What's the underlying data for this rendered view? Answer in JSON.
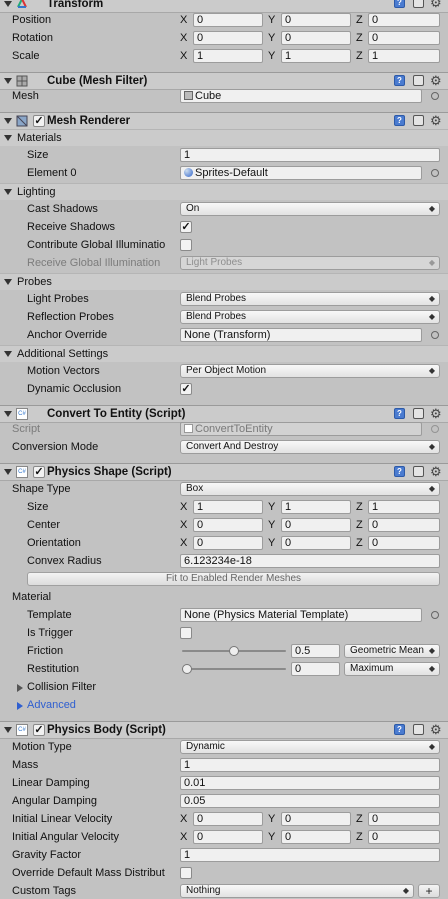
{
  "transform": {
    "title": "Transform",
    "rows": [
      {
        "label": "Position",
        "x": "0",
        "y": "0",
        "z": "0"
      },
      {
        "label": "Rotation",
        "x": "0",
        "y": "0",
        "z": "0"
      },
      {
        "label": "Scale",
        "x": "1",
        "y": "1",
        "z": "1"
      }
    ]
  },
  "axis": {
    "x": "X",
    "y": "Y",
    "z": "Z"
  },
  "mesh_filter": {
    "title": "Cube (Mesh Filter)",
    "mesh_label": "Mesh",
    "mesh_value": "Cube"
  },
  "mesh_renderer": {
    "title": "Mesh Renderer",
    "materials_header": "Materials",
    "size_label": "Size",
    "size_value": "1",
    "element0_label": "Element 0",
    "element0_value": "Sprites-Default",
    "lighting_header": "Lighting",
    "cast_shadows_label": "Cast Shadows",
    "cast_shadows_value": "On",
    "receive_shadows_label": "Receive Shadows",
    "contribute_gi_label": "Contribute Global Illuminatio",
    "receive_gi_label": "Receive Global Illumination",
    "receive_gi_value": "Light Probes",
    "probes_header": "Probes",
    "light_probes_label": "Light Probes",
    "light_probes_value": "Blend Probes",
    "reflection_probes_label": "Reflection Probes",
    "reflection_probes_value": "Blend Probes",
    "anchor_override_label": "Anchor Override",
    "anchor_override_value": "None (Transform)",
    "additional_header": "Additional Settings",
    "motion_vectors_label": "Motion Vectors",
    "motion_vectors_value": "Per Object Motion",
    "dynamic_occlusion_label": "Dynamic Occlusion"
  },
  "convert": {
    "title": "Convert To Entity (Script)",
    "script_label": "Script",
    "script_value": "ConvertToEntity",
    "mode_label": "Conversion Mode",
    "mode_value": "Convert And Destroy"
  },
  "physics_shape": {
    "title": "Physics Shape (Script)",
    "shape_type_label": "Shape Type",
    "shape_type_value": "Box",
    "size": {
      "label": "Size",
      "x": "1",
      "y": "1",
      "z": "1"
    },
    "center": {
      "label": "Center",
      "x": "0",
      "y": "0",
      "z": "0"
    },
    "orientation": {
      "label": "Orientation",
      "x": "0",
      "y": "0",
      "z": "0"
    },
    "convex_radius_label": "Convex Radius",
    "convex_radius_value": "6.123234e-18",
    "fit_button": "Fit to Enabled Render Meshes",
    "material_label": "Material",
    "template_label": "Template",
    "template_value": "None (Physics Material Template)",
    "is_trigger_label": "Is Trigger",
    "friction_label": "Friction",
    "friction_value": "0.5",
    "friction_fraction": 0.5,
    "friction_mode": "Geometric Mean",
    "restitution_label": "Restitution",
    "restitution_value": "0",
    "restitution_fraction": 0,
    "restitution_mode": "Maximum",
    "collision_filter_label": "Collision Filter",
    "advanced_label": "Advanced"
  },
  "physics_body": {
    "title": "Physics Body (Script)",
    "motion_type_label": "Motion Type",
    "motion_type_value": "Dynamic",
    "mass_label": "Mass",
    "mass_value": "1",
    "linear_damping_label": "Linear Damping",
    "linear_damping_value": "0.01",
    "angular_damping_label": "Angular Damping",
    "angular_damping_value": "0.05",
    "initial_linear_velocity": {
      "label": "Initial Linear Velocity",
      "x": "0",
      "y": "0",
      "z": "0"
    },
    "initial_angular_velocity": {
      "label": "Initial Angular Velocity",
      "x": "0",
      "y": "0",
      "z": "0"
    },
    "gravity_factor_label": "Gravity Factor",
    "gravity_factor_value": "1",
    "override_mass_label": "Override Default Mass Distribut",
    "custom_tags_label": "Custom Tags",
    "custom_tags_value": "Nothing",
    "add_button": "+"
  },
  "colors": {
    "link_blue": "#2f5fd0",
    "help_blue": "#4a7bd0",
    "panel_bg": "#c2c2c2"
  }
}
